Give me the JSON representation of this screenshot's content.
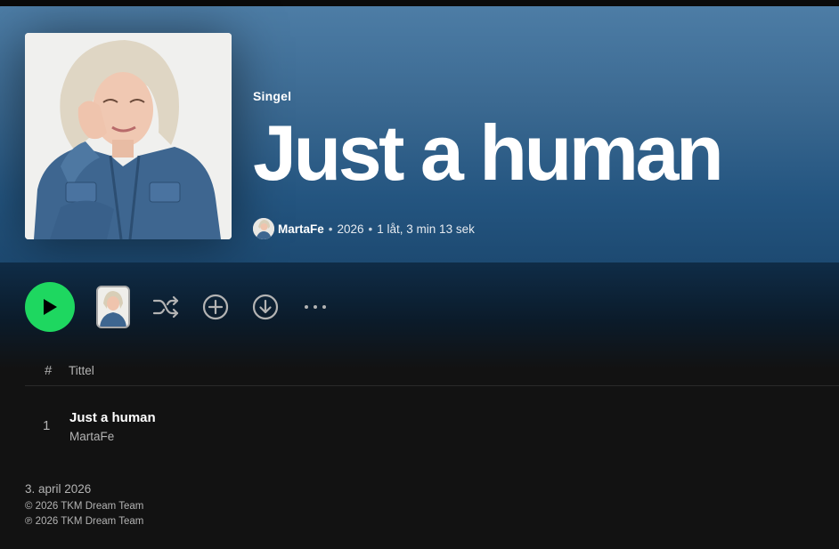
{
  "album": {
    "type": "Singel",
    "title": "Just a human",
    "artist": "MartaFe",
    "year": "2026",
    "summary": "1 låt, 3 min 13 sek",
    "separator": "•"
  },
  "actions": {
    "play_icon": "play-icon",
    "shuffle_icon": "shuffle-icon",
    "add_icon": "add-circle-icon",
    "download_icon": "download-icon",
    "more_icon": "more-icon"
  },
  "tracklist": {
    "header_num": "#",
    "header_title": "Tittel",
    "tracks": [
      {
        "num": "1",
        "title": "Just a human",
        "artist": "MartaFe"
      }
    ]
  },
  "footer": {
    "release_date": "3. april 2026",
    "copyright": "© 2026 TKM Dream Team",
    "phonogram": "℗ 2026 TKM Dream Team"
  },
  "colors": {
    "accent": "#1ed760",
    "hero_top": "#4e7ea7",
    "hero_bottom": "#1d4a72",
    "background": "#121212"
  }
}
